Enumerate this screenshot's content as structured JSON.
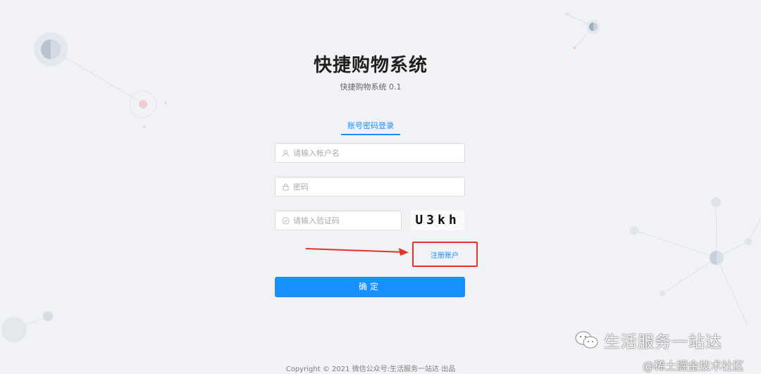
{
  "header": {
    "title": "快捷购物系统",
    "subtitle": "快捷购物系统 0.1"
  },
  "login_tab": {
    "label": "账号密码登录"
  },
  "form": {
    "username_placeholder": "请输入帐户名",
    "password_placeholder": "密码",
    "captcha_placeholder": "请输入验证码",
    "captcha_code": "U3kh",
    "register_link": "注册账户",
    "submit_label": "确定"
  },
  "footer": {
    "copyright": "Copyright © 2021 微信公众号:生活服务一站达 出品"
  },
  "watermarks": {
    "wechat_channel": "生活服务一站达",
    "juejin_credit": "@稀土掘金技术社区"
  },
  "colors": {
    "accent": "#1890ff",
    "highlight_red": "#e5322d",
    "background": "#f0f2f5"
  }
}
